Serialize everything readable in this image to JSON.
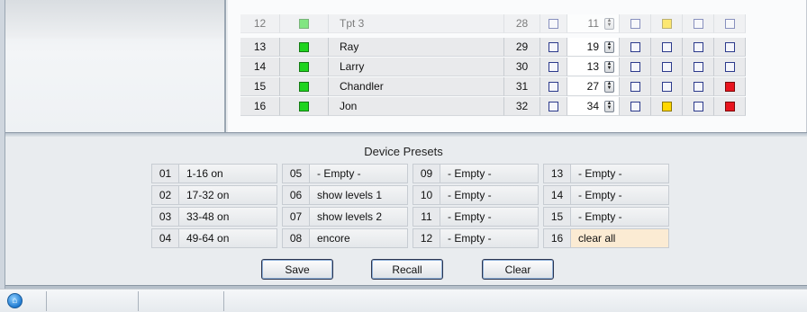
{
  "channels": [
    {
      "num": "12",
      "name": "Tpt 3",
      "num2": "28",
      "level": "11",
      "flags": [
        "none",
        "yellow",
        "none",
        "none"
      ],
      "faded": true
    },
    {
      "num": "13",
      "name": "Ray",
      "num2": "29",
      "level": "19",
      "flags": [
        "none",
        "none",
        "none",
        "none"
      ],
      "faded": false
    },
    {
      "num": "14",
      "name": "Larry",
      "num2": "30",
      "level": "13",
      "flags": [
        "none",
        "none",
        "none",
        "none"
      ],
      "faded": false
    },
    {
      "num": "15",
      "name": "Chandler",
      "num2": "31",
      "level": "27",
      "flags": [
        "none",
        "none",
        "none",
        "red"
      ],
      "faded": false
    },
    {
      "num": "16",
      "name": "Jon",
      "num2": "32",
      "level": "34",
      "flags": [
        "none",
        "yellow",
        "none",
        "red"
      ],
      "faded": false
    }
  ],
  "presets": {
    "title": "Device Presets",
    "items": [
      {
        "num": "01",
        "label": "1-16 on"
      },
      {
        "num": "02",
        "label": "17-32 on"
      },
      {
        "num": "03",
        "label": "33-48 on"
      },
      {
        "num": "04",
        "label": "49-64 on"
      },
      {
        "num": "05",
        "label": " - Empty -"
      },
      {
        "num": "06",
        "label": "show levels 1"
      },
      {
        "num": "07",
        "label": "show levels 2"
      },
      {
        "num": "08",
        "label": "encore"
      },
      {
        "num": "09",
        "label": " - Empty -"
      },
      {
        "num": "10",
        "label": " - Empty -"
      },
      {
        "num": "11",
        "label": " - Empty -"
      },
      {
        "num": "12",
        "label": " - Empty -"
      },
      {
        "num": "13",
        "label": " - Empty -"
      },
      {
        "num": "14",
        "label": " - Empty -"
      },
      {
        "num": "15",
        "label": " - Empty -"
      },
      {
        "num": "16",
        "label": "clear all"
      }
    ]
  },
  "buttons": {
    "save": "Save",
    "recall": "Recall",
    "clear": "Clear"
  },
  "colors": {
    "active": "#1fd41f",
    "yellow": "#ffd700",
    "red": "#e8141e",
    "highlight": "#fbebd3"
  },
  "icons": {
    "status": "app-logo-icon",
    "spinner": "spin-arrows-icon"
  }
}
